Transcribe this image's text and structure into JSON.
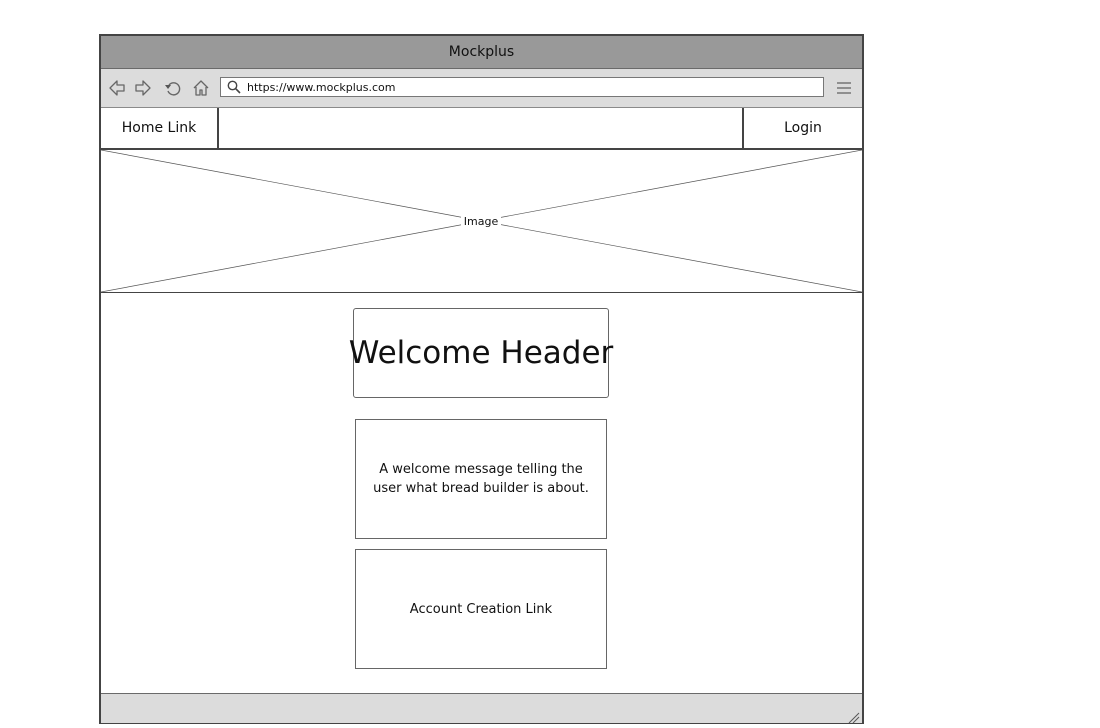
{
  "window": {
    "title": "Mockplus"
  },
  "toolbar": {
    "icons": [
      "back-icon",
      "forward-icon",
      "reload-icon",
      "home-icon",
      "search-icon",
      "menu-icon"
    ],
    "url": "https://www.mockplus.com"
  },
  "navbar": {
    "home_link": "Home Link",
    "login_link": "Login"
  },
  "hero": {
    "label": "Image"
  },
  "content": {
    "welcome_header": "Welcome Header",
    "welcome_message": "A welcome message telling the user what bread builder is about.",
    "account_link": "Account Creation Link"
  },
  "colors": {
    "titlebar": "#999999",
    "toolbar": "#dcdcdc",
    "border": "#444444"
  }
}
